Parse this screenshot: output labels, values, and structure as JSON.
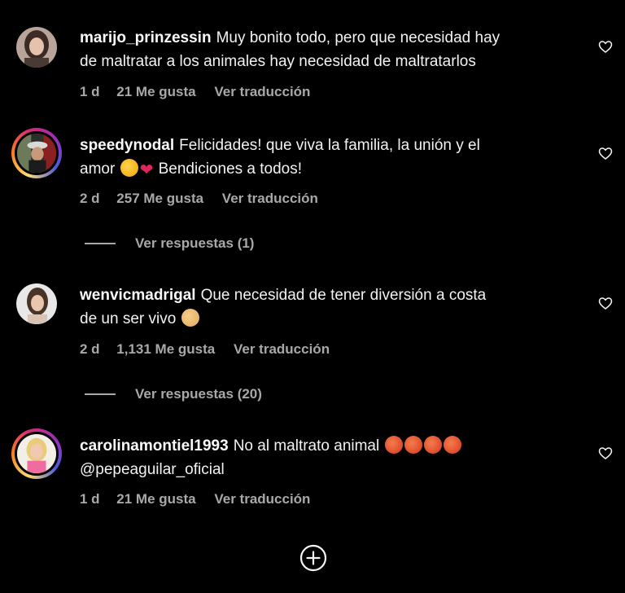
{
  "comments": [
    {
      "username": "marijo_prinzessin",
      "text_line1": "Muy bonito todo, pero que necesidad hay",
      "text_line2": "de maltratar a los animales hay necesidad de maltratarlos",
      "time": "1 d",
      "likes": "21 Me gusta",
      "translate": "Ver traducción",
      "avatar": "profile-photo",
      "has_story_ring": false
    },
    {
      "username": "speedynodal",
      "text_line1": "Felicidades! que viva la familia, la unión y el",
      "text_line2_prefix": "amor",
      "text_line2_suffix": "Bendiciones a todos!",
      "emojis": [
        "smiling-face-with-hearts",
        "heart-on-fire"
      ],
      "time": "2 d",
      "likes": "257 Me gusta",
      "translate": "Ver traducción",
      "replies": "Ver respuestas (1)",
      "has_story_ring": true
    },
    {
      "username": "wenvicmadrigal",
      "text_line1": "Que necesidad de tener diversión a costa",
      "text_line2": "de un ser vivo",
      "emojis": [
        "woman-facepalming"
      ],
      "time": "2 d",
      "likes": "1,131 Me gusta",
      "translate": "Ver traducción",
      "replies": "Ver respuestas (20)",
      "has_story_ring": false
    },
    {
      "username": "carolinamontiel1993",
      "text_line1": "No al maltrato animal",
      "text_line2": "@pepeaguilar_oficial",
      "emojis": [
        "angry-face",
        "angry-face",
        "angry-face",
        "angry-face"
      ],
      "time": "1 d",
      "likes": "21 Me gusta",
      "translate": "Ver traducción",
      "has_story_ring": true
    }
  ],
  "icons": {
    "like": "heart-outline-icon",
    "add": "plus-circle-icon"
  },
  "colors": {
    "background": "#000000",
    "primary_text": "#f5f5f5",
    "secondary_text": "#a8a8a8"
  }
}
